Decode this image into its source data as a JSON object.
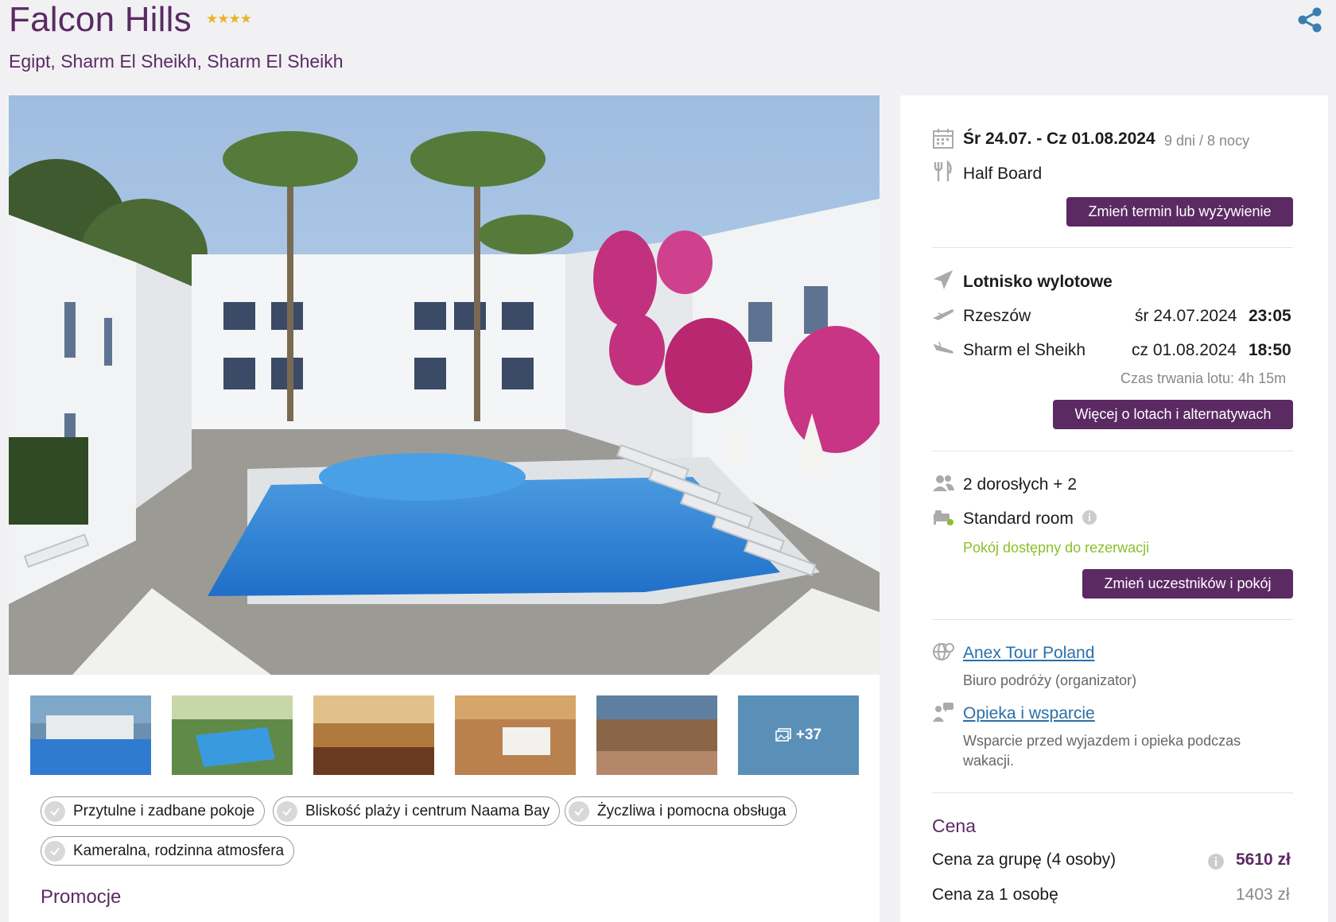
{
  "header": {
    "title": "Falcon Hills",
    "stars": "★★★★",
    "subtitle": "Egipt, Sharm El Sheikh, Sharm El Sheikh"
  },
  "gallery": {
    "more_label": "+37"
  },
  "features": [
    "Przytulne i zadbane pokoje",
    "Bliskość plaży i centrum Naama Bay",
    "Życzliwa i pomocna obsługa",
    "Kameralna, rodzinna atmosfera"
  ],
  "promo_heading": "Promocje",
  "booking": {
    "dates": "Śr 24.07. - Cz 01.08.2024",
    "duration": "9 dni / 8 nocy",
    "board": "Half Board",
    "change_date_button": "Zmień termin lub wyżywienie",
    "airport_label": "Lotnisko wylotowe",
    "flights": [
      {
        "city": "Rzeszów",
        "date": "śr 24.07.2024",
        "time": "23:05"
      },
      {
        "city": "Sharm el Sheikh",
        "date": "cz 01.08.2024",
        "time": "18:50"
      }
    ],
    "flight_duration": "Czas trwania lotu: 4h 15m",
    "flights_button": "Więcej o lotach i alternatywach",
    "participants": "2 dorosłych + 2",
    "room": "Standard room",
    "room_status": "Pokój dostępny do rezerwacji",
    "change_room_button": "Zmień uczestników i pokój",
    "organizer_link": "Anex Tour Poland",
    "organizer_desc": "Biuro podróży (organizator)",
    "support_link": "Opieka i wsparcie",
    "support_desc_1": "Wsparcie przed wyjazdem i opieka podczas",
    "support_desc_2": "wakacji.",
    "price_heading": "Cena",
    "group_price_label": "Cena za grupę (4 osoby)",
    "group_price": "5610 zł",
    "person_price_label": "Cena za 1 osobę",
    "person_price": "1403 zł"
  },
  "colors": {
    "brand": "#5b2a63",
    "available": "#8bbf2a",
    "link": "#2a6fa8"
  }
}
